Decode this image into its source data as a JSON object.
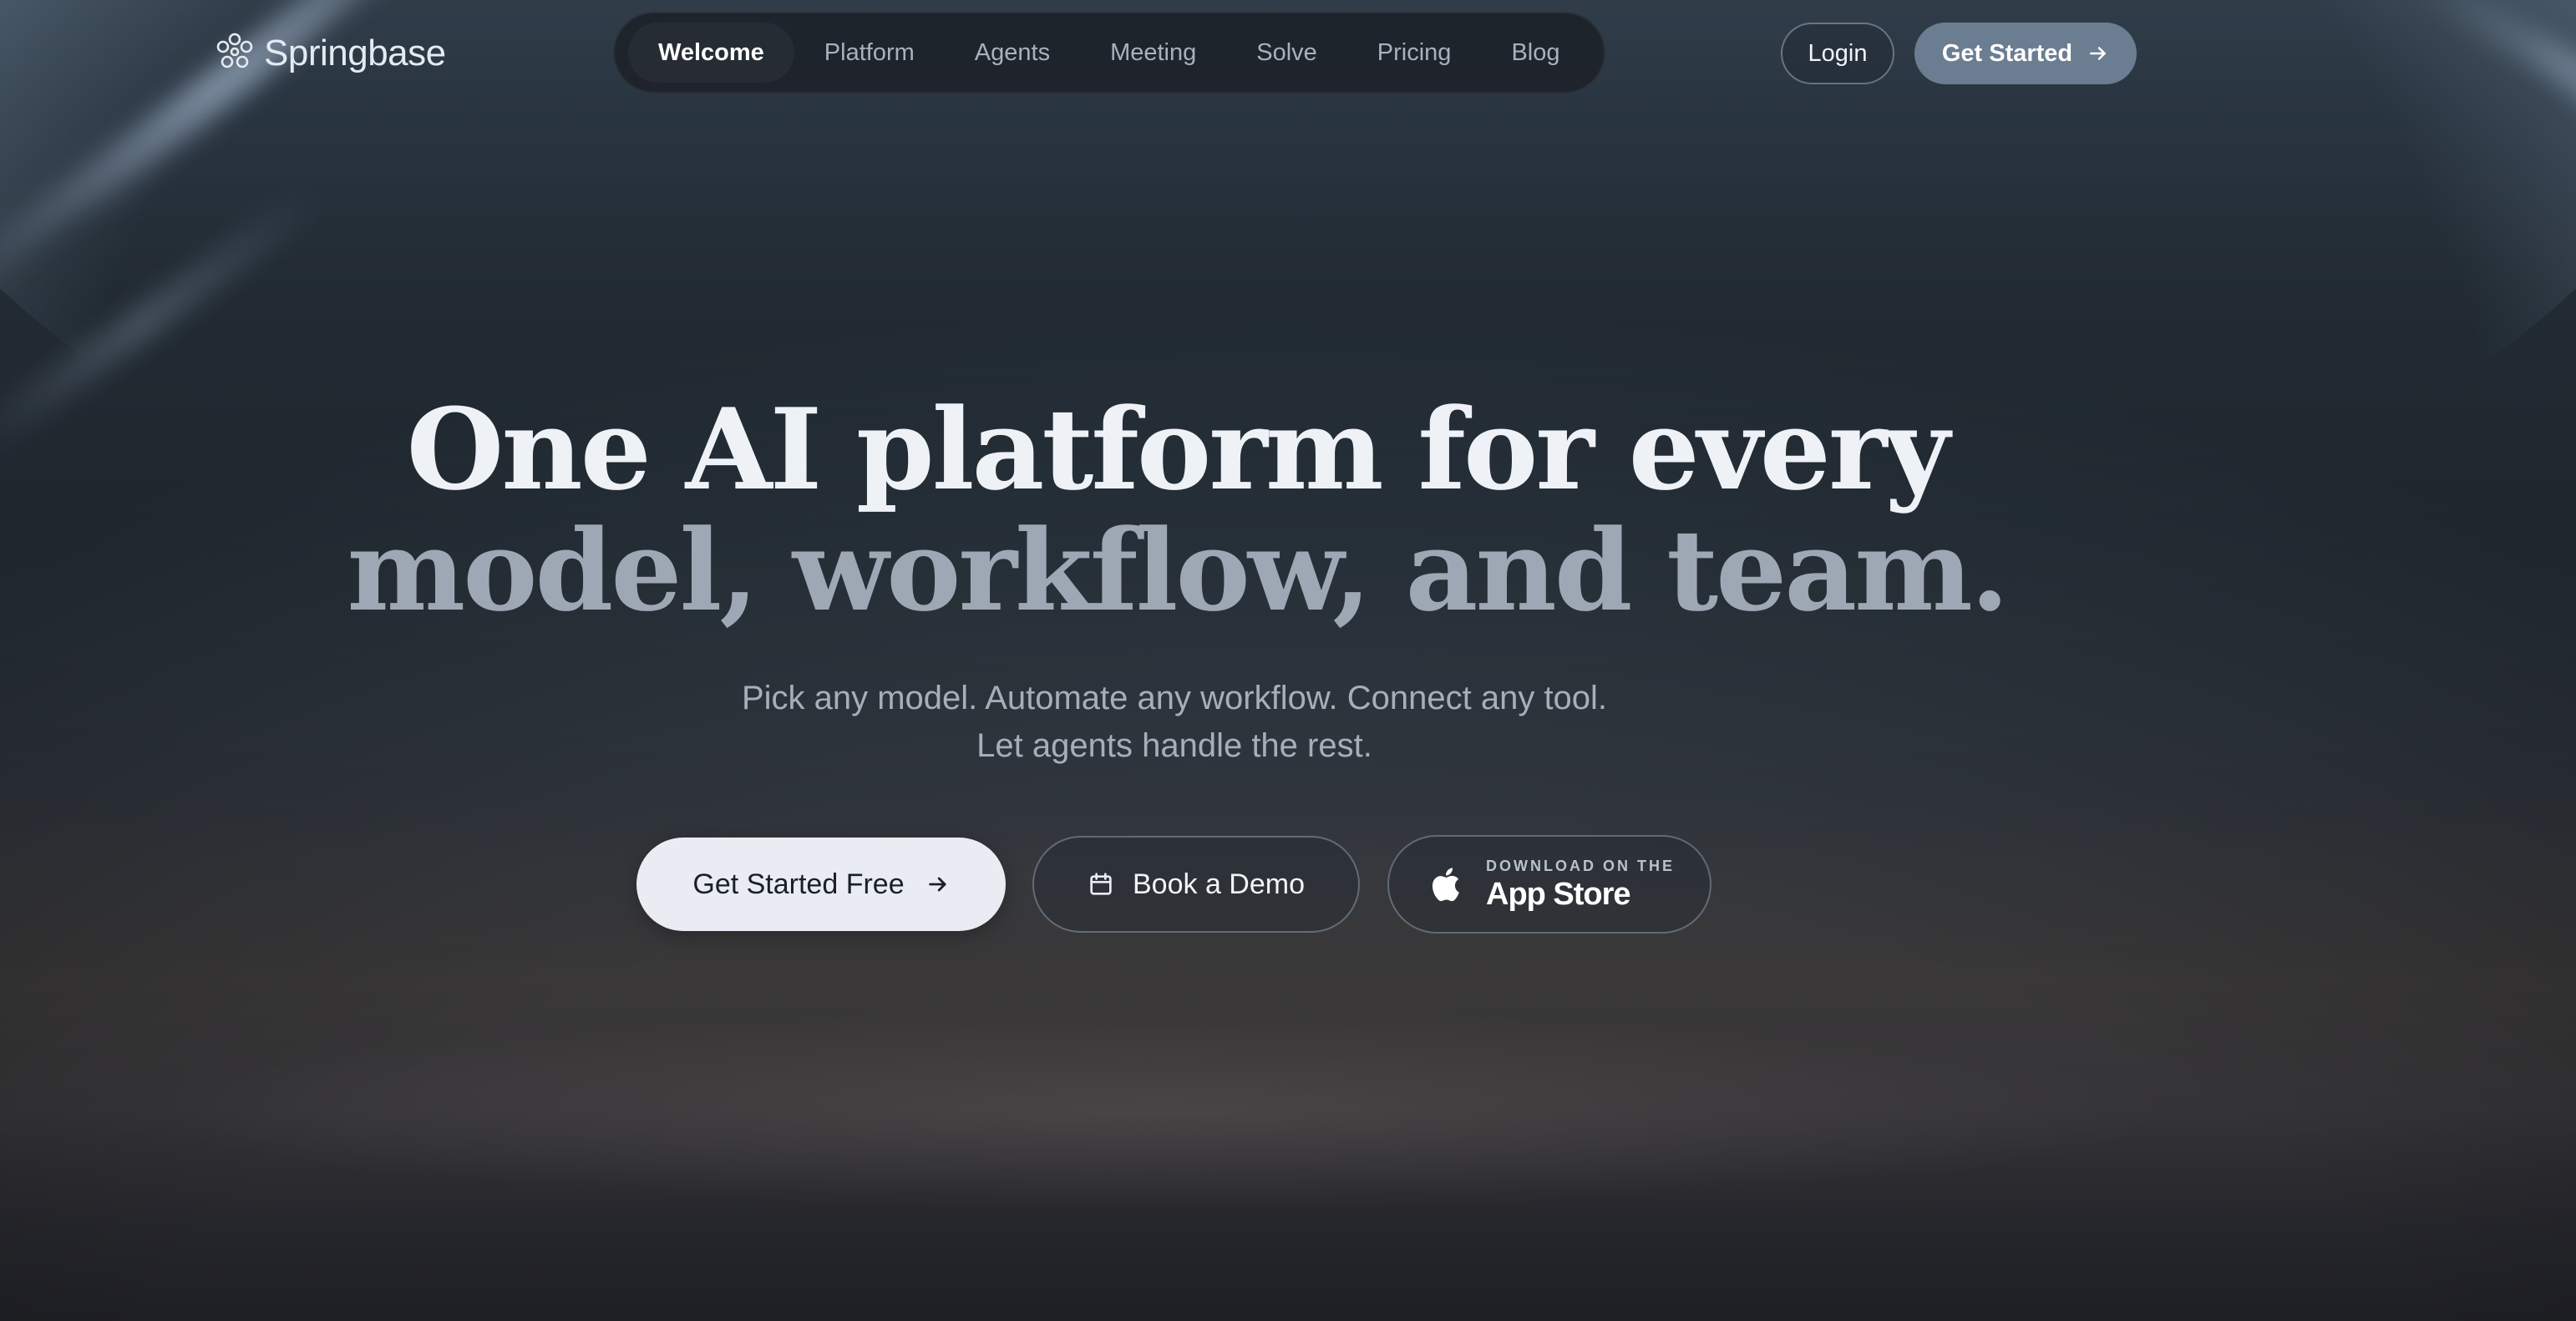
{
  "brand": {
    "name": "Springbase",
    "logo_icon": "springbase-logo-icon"
  },
  "nav": {
    "items": [
      {
        "label": "Welcome",
        "active": true
      },
      {
        "label": "Platform",
        "active": false
      },
      {
        "label": "Agents",
        "active": false
      },
      {
        "label": "Meeting",
        "active": false
      },
      {
        "label": "Solve",
        "active": false
      },
      {
        "label": "Pricing",
        "active": false
      },
      {
        "label": "Blog",
        "active": false
      }
    ],
    "login_label": "Login",
    "get_started_label": "Get Started",
    "get_started_icon": "arrow-right-icon"
  },
  "hero": {
    "headline_line1": "One AI platform for every",
    "headline_line2": "model, workflow, and team.",
    "subhead_line1": "Pick any model. Automate any workflow. Connect any tool.",
    "subhead_line2": "Let agents handle the rest.",
    "cta_primary_label": "Get Started Free",
    "cta_primary_icon": "arrow-right-icon",
    "cta_demo_label": "Book a Demo",
    "cta_demo_icon": "calendar-icon",
    "app_store_small": "DOWNLOAD ON THE",
    "app_store_big": "App Store",
    "app_store_icon": "apple-icon"
  },
  "colors": {
    "background_top": "#4a5d70",
    "background_bottom": "#1e1f24",
    "nav_pill": "#1c2129",
    "get_started_button": "#6b7d91",
    "primary_cta": "#e9edf3",
    "headline_primary": "#eef2f7",
    "headline_secondary": "#9ea8b5"
  }
}
